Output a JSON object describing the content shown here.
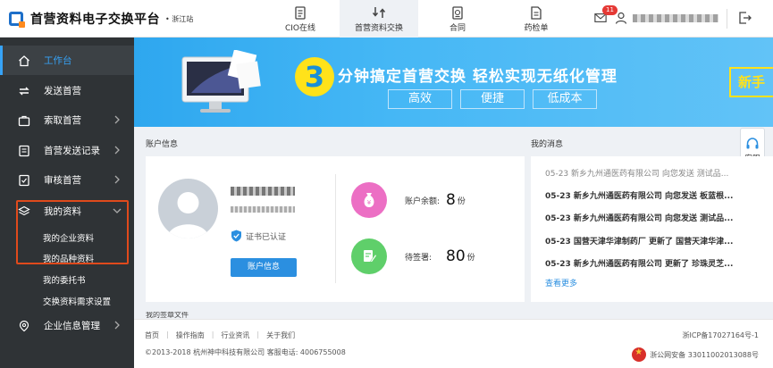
{
  "header": {
    "logo_text": "首营资料电子交换平台",
    "logo_sub": "• 浙江站",
    "tabs": [
      {
        "label": "CIO在线",
        "icon": "clipboard-icon"
      },
      {
        "label": "首营资料交换",
        "icon": "exchange-icon"
      },
      {
        "label": "合同",
        "icon": "contract-icon"
      },
      {
        "label": "药检单",
        "icon": "document-icon"
      }
    ],
    "message_badge": "11",
    "active_tab": "首营资料交换"
  },
  "sidebar": {
    "items": [
      {
        "label": "工作台",
        "icon": "home-icon",
        "active": true
      },
      {
        "label": "发送首营",
        "icon": "sync-icon"
      },
      {
        "label": "索取首营",
        "icon": "briefcase-icon"
      },
      {
        "label": "首营发送记录",
        "icon": "list-icon"
      },
      {
        "label": "审核首营",
        "icon": "approve-icon"
      },
      {
        "label": "我的资料",
        "icon": "layers-icon",
        "expanded": true
      },
      {
        "label": "企业信息管理",
        "icon": "building-icon"
      }
    ],
    "sub_items": [
      {
        "label": "我的企业资料"
      },
      {
        "label": "我的品种资料"
      },
      {
        "label": "我的委托书"
      },
      {
        "label": "交换资料需求设置"
      }
    ]
  },
  "banner": {
    "number": "3",
    "headline": "分钟搞定首营交换   轻松实现无纸化管理",
    "pills": [
      "高效",
      "便捷",
      "低成本"
    ],
    "cta": "新手"
  },
  "account": {
    "section_title": "账户信息",
    "cert_text": "证书已认证",
    "button": "账户信息",
    "balance_label": "账户余额:",
    "balance_value": "8",
    "balance_unit": "份",
    "pending_label": "待签署:",
    "pending_value": "80",
    "pending_unit": "份"
  },
  "messages": {
    "section_title": "我的消息",
    "rows": [
      {
        "text": "05-23  新乡九州通医药有限公司 向您发送  测试品...",
        "read": true
      },
      {
        "text": "05-23  新乡九州通医药有限公司 向您发送  板蓝根...",
        "read": false
      },
      {
        "text": "05-23  新乡九州通医药有限公司 向您发送  测试品...",
        "read": false
      },
      {
        "text": "05-23  国营天津华津制药厂 更新了  国营天津华津...",
        "read": false
      },
      {
        "text": "05-23  新乡九州通医药有限公司 更新了  珍珠灵芝...",
        "read": false
      }
    ],
    "more": "查看更多"
  },
  "kefu_label": "客服",
  "next_section_title": "我的签章文件",
  "footer": {
    "links": [
      "首页",
      "操作指南",
      "行业资讯",
      "关于我们"
    ],
    "copyright": "©2013-2018  杭州神中科技有限公司  客服电话: 4006755008",
    "icp": "浙ICP备17027164号-1",
    "police": "浙公网安备 33011002013088号"
  },
  "colors": {
    "accent": "#2b8fe0",
    "sidebar_bg": "#2f3336",
    "highlight": "#e04a1c",
    "banner": "#2ea7ef"
  }
}
